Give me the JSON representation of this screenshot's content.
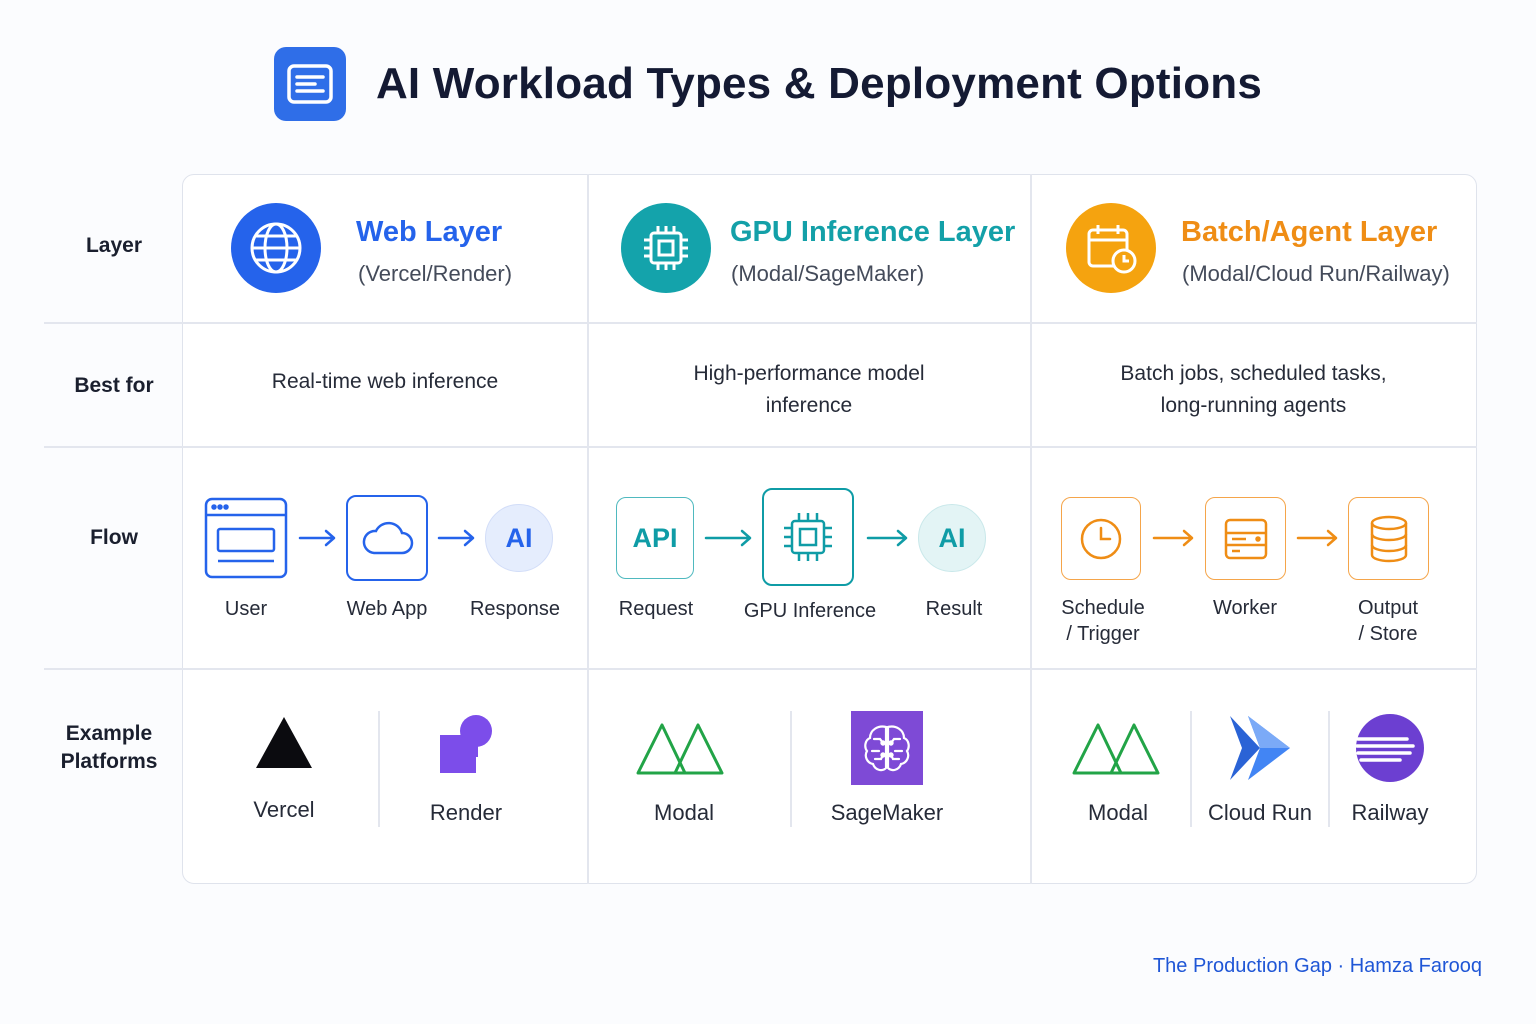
{
  "title": "AI Workload Types & Deployment Options",
  "title_icon": "document-list-icon",
  "row_labels": {
    "layer": "Layer",
    "best_for": "Best for",
    "flow": "Flow",
    "platforms": "Example Platforms"
  },
  "columns": [
    {
      "name": "Web Layer",
      "sub": "(Vercel/Render)",
      "icon": "globe-icon",
      "color": "#2563eb",
      "best_for": "Real-time web inference",
      "flow": [
        {
          "icon": "browser-window-icon",
          "caption": "User"
        },
        {
          "icon": "cloud-icon",
          "caption": "Web App"
        },
        {
          "text": "AI",
          "caption": "Response"
        }
      ],
      "platforms": [
        {
          "icon": "vercel-triangle-icon",
          "name": "Vercel"
        },
        {
          "icon": "render-logo-icon",
          "name": "Render"
        }
      ]
    },
    {
      "name": "GPU Inference Layer",
      "sub": "(Modal/SageMaker)",
      "icon": "cpu-chip-icon",
      "color": "#0f9ca6",
      "best_for_lines": [
        "High-performance model",
        "inference"
      ],
      "flow": [
        {
          "text": "API",
          "caption": "Request"
        },
        {
          "icon": "cpu-chip-icon",
          "caption": "GPU Inference"
        },
        {
          "text": "AI",
          "caption": "Result"
        }
      ],
      "platforms": [
        {
          "icon": "modal-logo-icon",
          "name": "Modal"
        },
        {
          "icon": "sagemaker-brain-icon",
          "name": "SageMaker"
        }
      ]
    },
    {
      "name": "Batch/Agent Layer",
      "sub": "(Modal/Cloud Run/Railway)",
      "icon": "calendar-clock-icon",
      "color": "#f08c16",
      "best_for_lines": [
        "Batch jobs, scheduled tasks,",
        "long-running agents"
      ],
      "flow": [
        {
          "icon": "clock-icon",
          "caption_lines": [
            "Schedule",
            "/ Trigger"
          ]
        },
        {
          "icon": "server-icon",
          "caption": "Worker"
        },
        {
          "icon": "database-icon",
          "caption_lines": [
            "Output",
            "/ Store"
          ]
        }
      ],
      "platforms": [
        {
          "icon": "modal-logo-icon",
          "name": "Modal"
        },
        {
          "icon": "cloud-run-icon",
          "name": "Cloud Run"
        },
        {
          "icon": "railway-logo-icon",
          "name": "Railway"
        }
      ]
    }
  ],
  "footer": "The Production Gap · Hamza Farooq"
}
